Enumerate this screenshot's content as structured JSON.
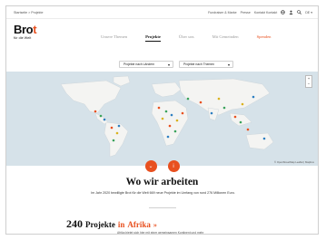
{
  "utility": {
    "breadcrumb": "Startseite > Projekte",
    "links": [
      "Fundraiser & Marke",
      "Presse",
      "Kontakt Kontakt"
    ],
    "lang": "DE ▾"
  },
  "logo": {
    "brand_main": "Bro",
    "brand_accent": "t",
    "tagline": "für die Welt"
  },
  "nav": {
    "items": [
      "Unsere Themen",
      "Projekte",
      "Über uns",
      "Mit Gemeinden",
      "Spenden"
    ]
  },
  "filters": {
    "country_label": "Projekte nach Ländern",
    "topic_label": "Projekte nach Themen"
  },
  "map": {
    "zoom_in": "+",
    "zoom_out": "−",
    "attribution": "© OpenStreetMap Leaflet | Mapbox",
    "water_color": "#d6e2e9",
    "land_color": "#f4f4f2",
    "marker_colors": [
      "#e8501f",
      "#3aa35b",
      "#2e7fc1",
      "#d9b21e"
    ]
  },
  "buttons": {
    "down_label": "⌄",
    "info_label": "i"
  },
  "main": {
    "heading": "Wo wir arbeiten",
    "intro": "Im Jahr 2020 bewilligte Brot für die Welt 669 neue Projekte im Umfang von rund 276 Millionen Euro."
  },
  "projects": {
    "count": "240",
    "label": "Projekte",
    "in": "in",
    "region": "Afrika",
    "arrow": "»",
    "subline": "Afrika bietet sich hier mit einer gemeinsamen Kontinent und mehr"
  }
}
